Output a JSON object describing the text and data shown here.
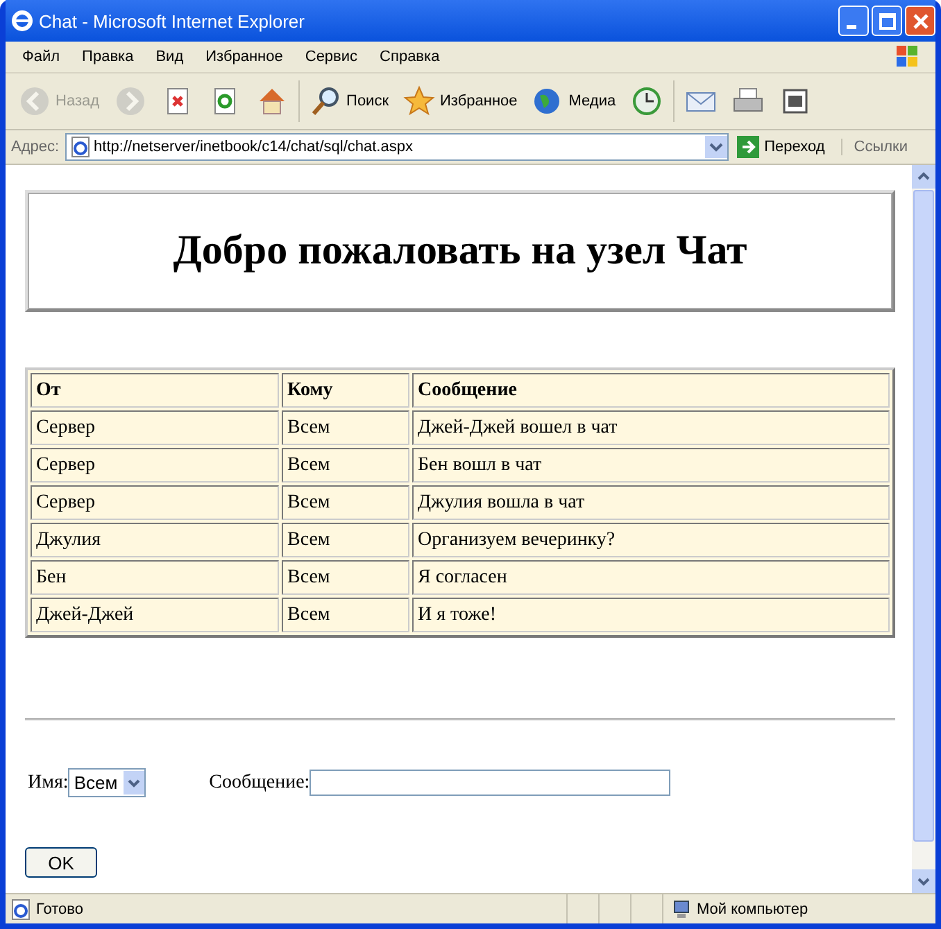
{
  "window": {
    "title": "Chat - Microsoft Internet Explorer"
  },
  "menu": [
    "Файл",
    "Правка",
    "Вид",
    "Избранное",
    "Сервис",
    "Справка"
  ],
  "toolbar": [
    {
      "kind": "back",
      "label": "Назад",
      "disabled": true
    },
    {
      "kind": "forward",
      "disabled": true
    },
    {
      "kind": "stop",
      "disabled": false
    },
    {
      "kind": "refresh",
      "disabled": false
    },
    {
      "kind": "home",
      "disabled": false
    },
    {
      "kind": "search",
      "label": "Поиск",
      "disabled": false
    },
    {
      "kind": "favorites",
      "label": "Избранное",
      "disabled": false
    },
    {
      "kind": "media",
      "label": "Медиа",
      "disabled": false
    },
    {
      "kind": "history",
      "disabled": false
    },
    {
      "kind": "mail",
      "disabled": false
    },
    {
      "kind": "print",
      "disabled": false
    },
    {
      "kind": "edit",
      "disabled": false
    }
  ],
  "address": {
    "label": "Адрес:",
    "value": "http://netserver/inetbook/c14/chat/sql/chat.aspx",
    "go": "Переход",
    "links": "Ссылки"
  },
  "page": {
    "heading": "Добро пожаловать на узел Чат",
    "table": {
      "columns": [
        "От",
        "Кому",
        "Сообщение"
      ],
      "rows": [
        [
          "Сервер",
          "Всем",
          "Джей-Джей вошел в чат"
        ],
        [
          "Сервер",
          "Всем",
          "Бен вошл в чат"
        ],
        [
          "Сервер",
          "Всем",
          "Джулия вошла в чат"
        ],
        [
          "Джулия",
          "Всем",
          "Организуем вечеринку?"
        ],
        [
          "Бен",
          "Всем",
          "Я согласен"
        ],
        [
          "Джей-Джей",
          "Всем",
          "И я тоже!"
        ]
      ]
    },
    "name_label": "Имя:",
    "name_value": "Всем",
    "message_label": "Сообщение:",
    "ok": "OK"
  },
  "status_bar": {
    "text": "Готово",
    "zone": "Мой компьютер"
  }
}
